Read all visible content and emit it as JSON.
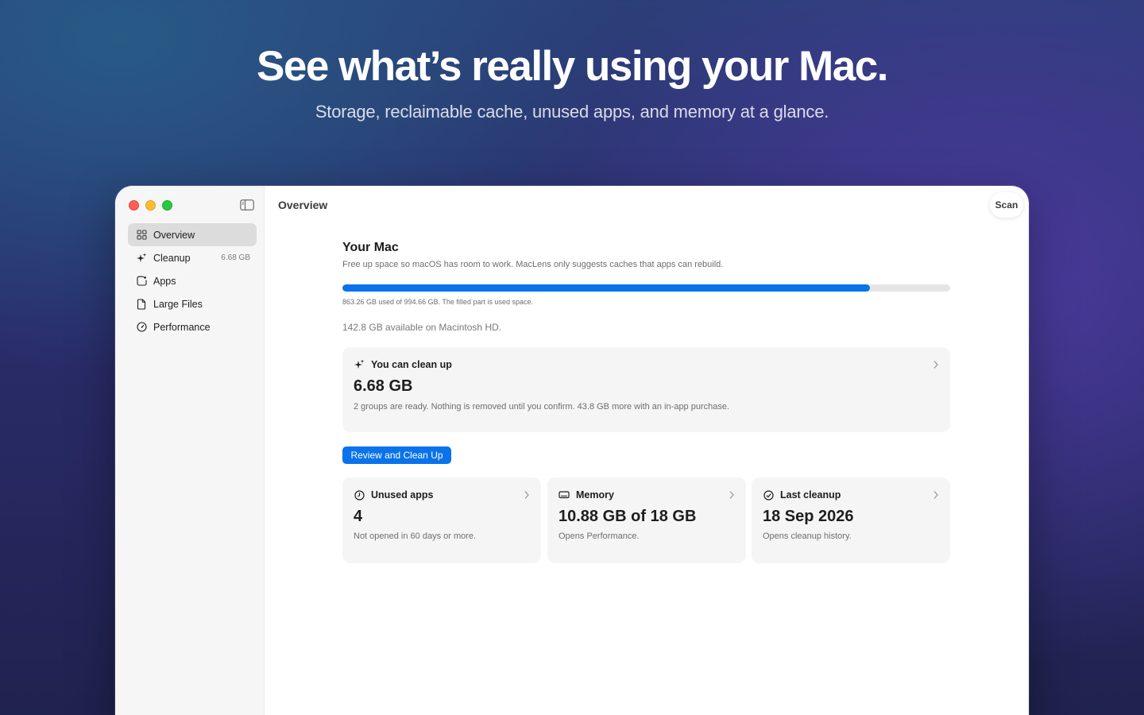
{
  "hero": {
    "title": "See what’s really using your Mac.",
    "subtitle": "Storage, reclaimable cache, unused apps, and memory at a glance."
  },
  "toolbar": {
    "title": "Overview",
    "scan_label": "Scan"
  },
  "sidebar": {
    "items": [
      {
        "label": "Overview",
        "icon": "grid-icon",
        "badge": "",
        "active": true
      },
      {
        "label": "Cleanup",
        "icon": "sparkles-icon",
        "badge": "6.68 GB",
        "active": false
      },
      {
        "label": "Apps",
        "icon": "apps-icon",
        "badge": "",
        "active": false
      },
      {
        "label": "Large Files",
        "icon": "document-icon",
        "badge": "",
        "active": false
      },
      {
        "label": "Performance",
        "icon": "gauge-icon",
        "badge": "",
        "active": false
      }
    ]
  },
  "main": {
    "heading": "Your Mac",
    "intro": "Free up space so macOS has room to work. MacLens only suggests caches that apps can rebuild.",
    "storage": {
      "used_fraction": 0.8676,
      "usage_text": "863.26 GB used of 994.66 GB. The filled part is used space.",
      "available_text": "142.8 GB available on Macintosh HD."
    },
    "cleanup_card": {
      "title": "You can clean up",
      "value": "6.68 GB",
      "description": "2 groups are ready. Nothing is removed until you confirm. 43.8 GB more with an in-app purchase."
    },
    "review_button": "Review and Clean Up",
    "stats": [
      {
        "title": "Unused apps",
        "icon": "clock-icon",
        "value": "4",
        "description": "Not opened in 60 days or more."
      },
      {
        "title": "Memory",
        "icon": "memory-icon",
        "value": "10.88 GB of 18 GB",
        "description": "Opens Performance."
      },
      {
        "title": "Last cleanup",
        "icon": "checkmark-circle-icon",
        "value": "18 Sep 2026",
        "description": "Opens cleanup history."
      }
    ]
  },
  "colors": {
    "accent": "#0a72ea",
    "close": "#ff5f57",
    "minimize": "#febc2e",
    "zoom": "#28c840"
  }
}
